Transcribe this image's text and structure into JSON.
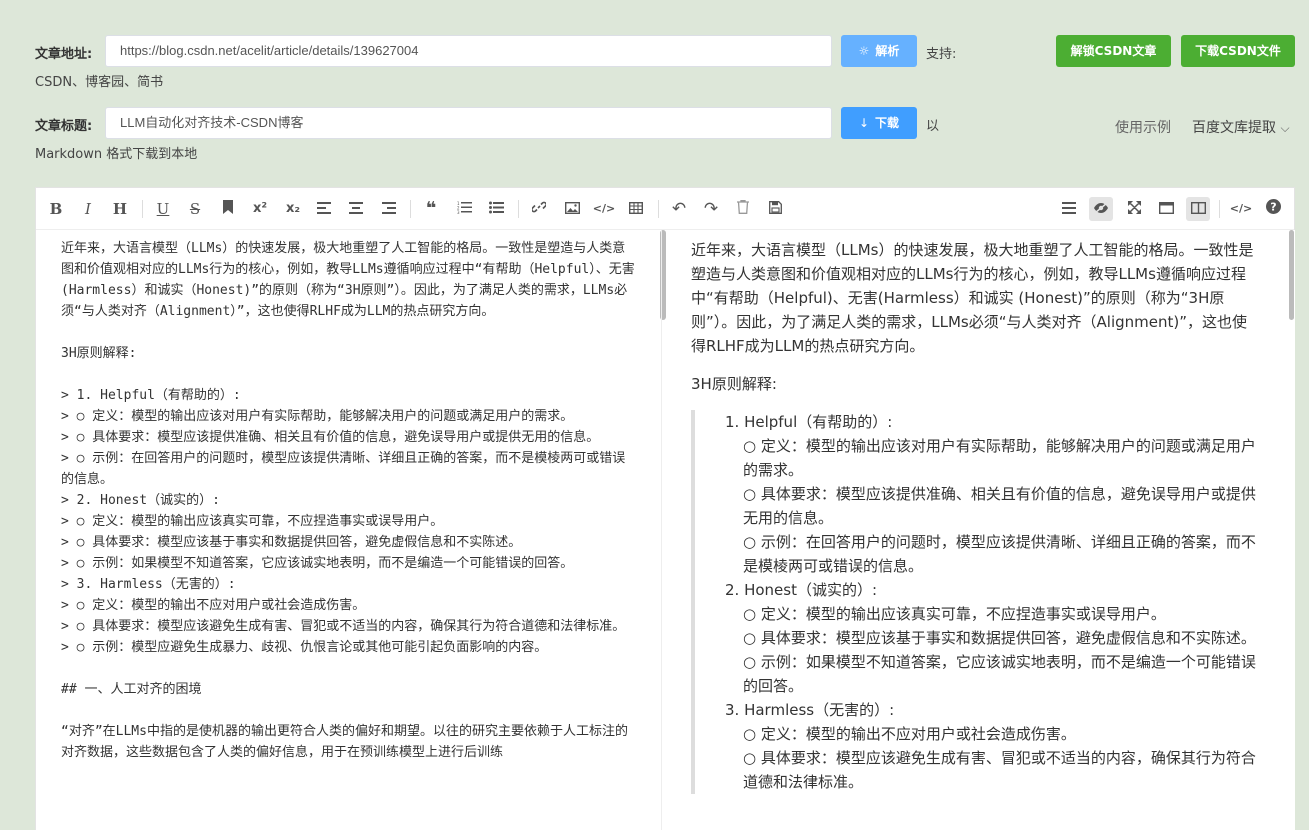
{
  "form": {
    "url_label": "文章地址:",
    "url_value": "https://blog.csdn.net/acelit/article/details/139627004",
    "parse_button": "解析",
    "support_text": "支持:",
    "support_sites": "CSDN、博客园、简书",
    "unlock_button": "解锁CSDN文章",
    "download_file_button": "下载CSDN文件",
    "title_label": "文章标题:",
    "title_value": "LLM自动化对齐技术-CSDN博客",
    "download_button": "下载",
    "format_prefix": "以",
    "format_text": "Markdown 格式下载到本地",
    "example_link": "使用示例",
    "baidu_link": "百度文库提取"
  },
  "toolbar": {
    "icons": [
      "bold-icon",
      "italic-icon",
      "header-icon",
      "underline-icon",
      "strikethrough-icon",
      "bookmark-icon",
      "superscript-icon",
      "subscript-icon",
      "align-left-icon",
      "align-center-icon",
      "align-right-icon",
      "quote-icon",
      "ordered-list-icon",
      "unordered-list-icon",
      "link-icon",
      "image-icon",
      "code-icon",
      "table-icon",
      "undo-icon",
      "redo-icon",
      "trash-icon",
      "save-icon",
      "menu-icon",
      "preview-icon",
      "fullscreen-icon",
      "window-icon",
      "split-view-icon",
      "html-icon",
      "help-icon"
    ]
  },
  "source": {
    "text": "近年来，大语言模型（LLMs）的快速发展，极大地重塑了人工智能的格局。一致性是塑造与人类意图和价值观相对应的LLMs行为的核心，例如，教导LLMs遵循响应过程中“有帮助（Helpful）、无害(Harmless）和诚实（Honest)”的原则（称为“3H原则”）。因此，为了满足人类的需求，LLMs必须“与人类对齐（Alignment）”，这也使得RLHF成为LLM的热点研究方向。\n\n3H原则解释:\n\n> 1. Helpful（有帮助的）:\n> ○ 定义：模型的输出应该对用户有实际帮助，能够解决用户的问题或满足用户的需求。\n> ○ 具体要求：模型应该提供准确、相关且有价值的信息，避免误导用户或提供无用的信息。\n> ○ 示例：在回答用户的问题时，模型应该提供清晰、详细且正确的答案，而不是模棱两可或错误的信息。\n> 2. Honest（诚实的）:\n> ○ 定义：模型的输出应该真实可靠，不应捏造事实或误导用户。\n> ○ 具体要求：模型应该基于事实和数据提供回答，避免虚假信息和不实陈述。\n> ○ 示例：如果模型不知道答案，它应该诚实地表明，而不是编造一个可能错误的回答。\n> 3. Harmless（无害的）:\n> ○ 定义：模型的输出不应对用户或社会造成伤害。\n> ○ 具体要求：模型应该避免生成有害、冒犯或不适当的内容，确保其行为符合道德和法律标准。\n> ○ 示例：模型应避免生成暴力、歧视、仇恨言论或其他可能引起负面影响的内容。\n\n## 一、人工对齐的困境\n\n“对齐”在LLMs中指的是使机器的输出更符合人类的偏好和期望。以往的研究主要依赖于人工标注的对齐数据，这些数据包含了人类的偏好信息，用于在预训练模型上进行后训练"
  },
  "preview": {
    "intro": "近年来，大语言模型（LLMs）的快速发展，极大地重塑了人工智能的格局。一致性是塑造与人类意图和价值观相对应的LLMs行为的核心，例如，教导LLMs遵循响应过程中“有帮助（Helpful)、无害(Harmless）和诚实 (Honest)”的原则（称为“3H原则”）。因此，为了满足人类的需求，LLMs必须“与人类对齐（Alignment)”，这也使得RLHF成为LLM的热点研究方向。",
    "heading": "3H原则解释:",
    "items": [
      {
        "title": "1. Helpful（有帮助的）:",
        "subs": [
          "○ 定义：模型的输出应该对用户有实际帮助，能够解决用户的问题或满足用户的需求。",
          "○ 具体要求：模型应该提供准确、相关且有价值的信息，避免误导用户或提供无用的信息。",
          "○ 示例：在回答用户的问题时，模型应该提供清晰、详细且正确的答案，而不是模棱两可或错误的信息。"
        ]
      },
      {
        "title": "2. Honest（诚实的）:",
        "subs": [
          "○ 定义：模型的输出应该真实可靠，不应捏造事实或误导用户。",
          "○ 具体要求：模型应该基于事实和数据提供回答，避免虚假信息和不实陈述。",
          "○ 示例：如果模型不知道答案，它应该诚实地表明，而不是编造一个可能错误的回答。"
        ]
      },
      {
        "title": "3. Harmless（无害的）:",
        "subs": [
          "○ 定义：模型的输出不应对用户或社会造成伤害。",
          "○ 具体要求：模型应该避免生成有害、冒犯或不适当的内容，确保其行为符合道德和法律标准。"
        ]
      }
    ]
  },
  "colors": {
    "background": "#dde7d9",
    "parse_button": "#66b1ff",
    "download_button": "#409eff",
    "green_button": "#4cae33"
  }
}
